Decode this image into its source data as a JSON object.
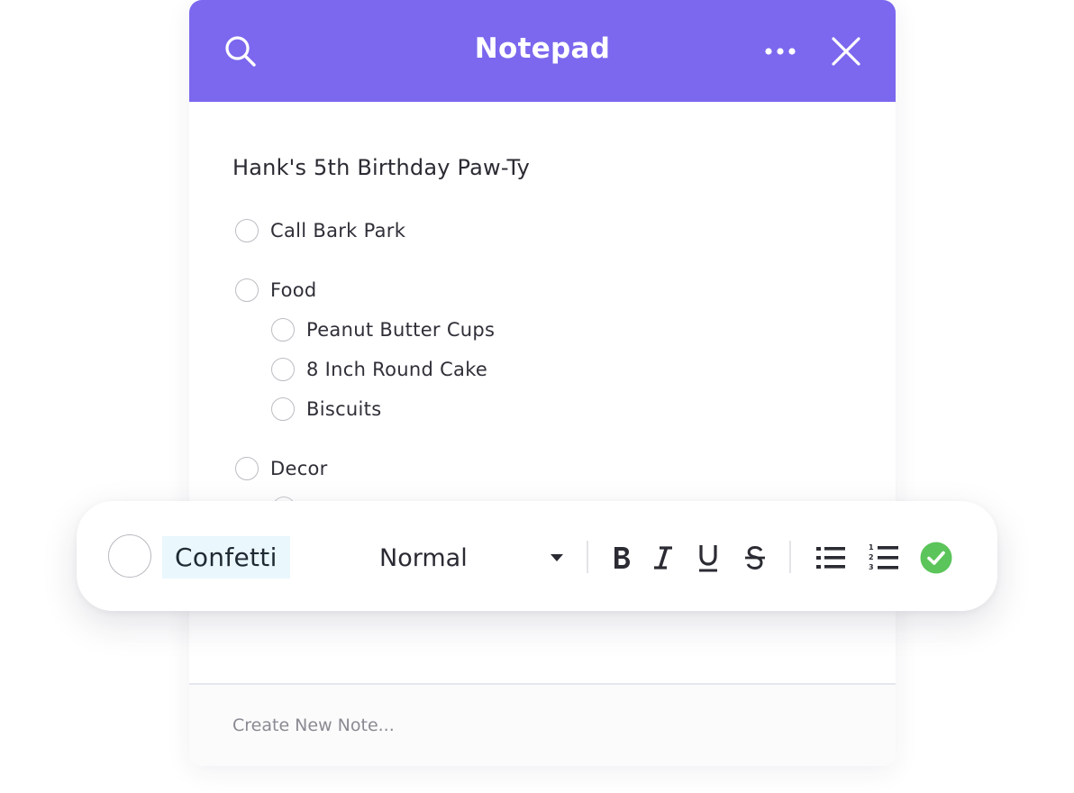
{
  "header": {
    "title": "Notepad",
    "color": "#7B68EE",
    "icons": [
      "search-icon",
      "more-icon",
      "close-icon"
    ]
  },
  "note": {
    "title": "Hank's 5th Birthday Paw-Ty",
    "items": [
      {
        "label": "Call Bark Park",
        "checked": false,
        "level": 0
      },
      {
        "label": "Food",
        "checked": false,
        "level": 0
      },
      {
        "label": "Peanut Butter Cups",
        "checked": false,
        "level": 1
      },
      {
        "label": "8 Inch Round Cake",
        "checked": false,
        "level": 1
      },
      {
        "label": "Biscuits",
        "checked": false,
        "level": 1
      },
      {
        "label": "Decor",
        "checked": false,
        "level": 0
      }
    ]
  },
  "editor": {
    "current_text": "Confetti",
    "text_style": "Normal",
    "format_buttons": [
      "bold-icon",
      "italic-icon",
      "underline-icon",
      "strikethrough-icon",
      "bullet-list-icon",
      "numbered-list-icon",
      "confirm-check-icon"
    ],
    "confirm_color": "#5BC45A"
  },
  "footer": {
    "new_note_placeholder": "Create New Note..."
  }
}
